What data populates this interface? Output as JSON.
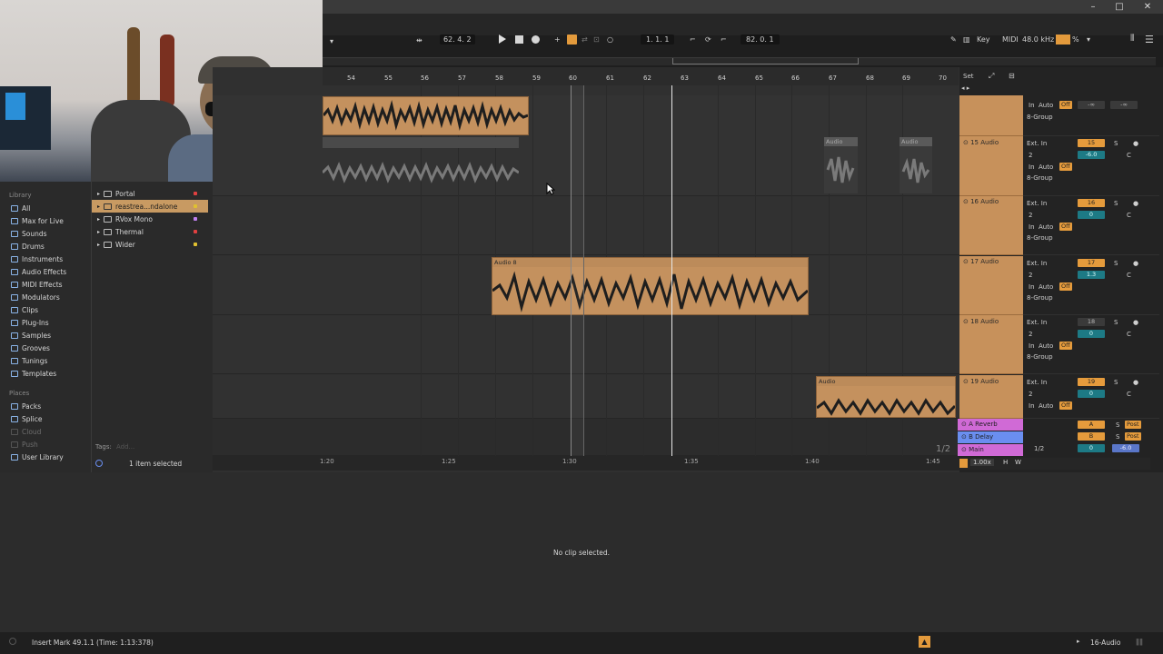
{
  "window": {
    "controls": [
      "–",
      "□",
      "✕"
    ]
  },
  "transport": {
    "follow_label": "62. 4. 2",
    "position": "1. 1. 1",
    "loop_end": "82. 0. 1",
    "key_label": "Key",
    "midi_label": "MIDI",
    "sample_rate": "48.0 kHz",
    "cpu": "%"
  },
  "arrangement_header": {
    "set_label": "Set"
  },
  "ruler": {
    "bars": [
      "54",
      "55",
      "56",
      "57",
      "58",
      "59",
      "60",
      "61",
      "62",
      "63",
      "64",
      "65",
      "66",
      "67",
      "68",
      "69",
      "70"
    ]
  },
  "time_ruler": {
    "marks": [
      "1:20",
      "1:25",
      "1:30",
      "1:35",
      "1:40",
      "1:45"
    ]
  },
  "browser": {
    "library_label": "Library",
    "categories": [
      {
        "label": "All",
        "icon": "list-icon"
      },
      {
        "label": "Max for Live",
        "icon": "max-icon"
      },
      {
        "label": "Sounds",
        "icon": "sounds-icon"
      },
      {
        "label": "Drums",
        "icon": "drums-icon"
      },
      {
        "label": "Instruments",
        "icon": "instruments-icon"
      },
      {
        "label": "Audio Effects",
        "icon": "audio-effects-icon"
      },
      {
        "label": "MIDI Effects",
        "icon": "midi-effects-icon"
      },
      {
        "label": "Modulators",
        "icon": "modulators-icon"
      },
      {
        "label": "Clips",
        "icon": "clips-icon"
      },
      {
        "label": "Plug-Ins",
        "icon": "plugins-icon"
      },
      {
        "label": "Samples",
        "icon": "samples-icon"
      },
      {
        "label": "Grooves",
        "icon": "grooves-icon"
      },
      {
        "label": "Tunings",
        "icon": "tunings-icon"
      },
      {
        "label": "Templates",
        "icon": "templates-icon"
      }
    ],
    "places_label": "Places",
    "places": [
      {
        "label": "Packs",
        "dim": false
      },
      {
        "label": "Splice",
        "dim": false
      },
      {
        "label": "Cloud",
        "dim": true
      },
      {
        "label": "Push",
        "dim": true
      },
      {
        "label": "User Library",
        "dim": false
      }
    ],
    "content_items": [
      {
        "label": "Portal",
        "dot": "#e04040",
        "sel": false
      },
      {
        "label": "reastrea...ndalone",
        "dot": "#e0c030",
        "sel": true
      },
      {
        "label": "RVox Mono",
        "dot": "#c080f0",
        "sel": false
      },
      {
        "label": "Thermal",
        "dot": "#e04040",
        "sel": false
      },
      {
        "label": "Wider",
        "dot": "#e0c030",
        "sel": false
      }
    ],
    "tags_label": "Tags:",
    "tags_add": "Add...",
    "selection_status": "1 item selected"
  },
  "tracks": [
    {
      "name": "",
      "number": "",
      "in_label": "In",
      "auto_label": "Auto",
      "off_label": "Off",
      "group": "8-Group",
      "vol": "-∞",
      "pan": "-∞"
    },
    {
      "name": "15 Audio",
      "number": "15",
      "input": "Ext. In",
      "channel": "2",
      "in_label": "In",
      "auto_label": "Auto",
      "off_label": "Off",
      "group": "8-Group",
      "vol": "-6.0",
      "pan": "C"
    },
    {
      "name": "16 Audio",
      "number": "16",
      "input": "Ext. In",
      "channel": "2",
      "in_label": "In",
      "auto_label": "Auto",
      "off_label": "Off",
      "group": "8-Group",
      "vol": "0",
      "pan": "C"
    },
    {
      "name": "17 Audio",
      "number": "17",
      "input": "Ext. In",
      "channel": "2",
      "in_label": "In",
      "auto_label": "Auto",
      "off_label": "Off",
      "group": "8-Group",
      "vol": "1.3",
      "pan": "C"
    },
    {
      "name": "18 Audio",
      "number": "18",
      "input": "Ext. In",
      "channel": "2",
      "in_label": "In",
      "auto_label": "Auto",
      "off_label": "Off",
      "group": "8-Group",
      "vol": "0",
      "pan": "C"
    },
    {
      "name": "19 Audio",
      "number": "19",
      "input": "Ext. In",
      "channel": "2",
      "in_label": "In",
      "auto_label": "Auto",
      "off_label": "Off",
      "group": "",
      "vol": "0",
      "pan": "C"
    }
  ],
  "returns": [
    {
      "name": "A Reverb",
      "letter": "A",
      "color": "#d06ad6",
      "post": "Post"
    },
    {
      "name": "B Delay",
      "letter": "B",
      "color": "#6a8ef0",
      "post": "Post"
    }
  ],
  "main": {
    "name": "Main",
    "ratio": "1/2",
    "vol": "0",
    "pan": "-6.0",
    "page": "1/2"
  },
  "zoom": "1.00x",
  "hw": [
    "H",
    "W"
  ],
  "clips": [
    {
      "name": "",
      "lane": 0
    },
    {
      "name": "Audio",
      "lane": 1
    },
    {
      "name": "Audio",
      "lane": 1
    },
    {
      "name": "Audio 8",
      "lane": 3
    },
    {
      "name": "Audio",
      "lane": 5
    }
  ],
  "detail": {
    "empty_text": "No clip selected."
  },
  "status": {
    "message": "Insert Mark 49.1.1 (Time: 1:13:378)",
    "track_label": "16-Audio"
  }
}
